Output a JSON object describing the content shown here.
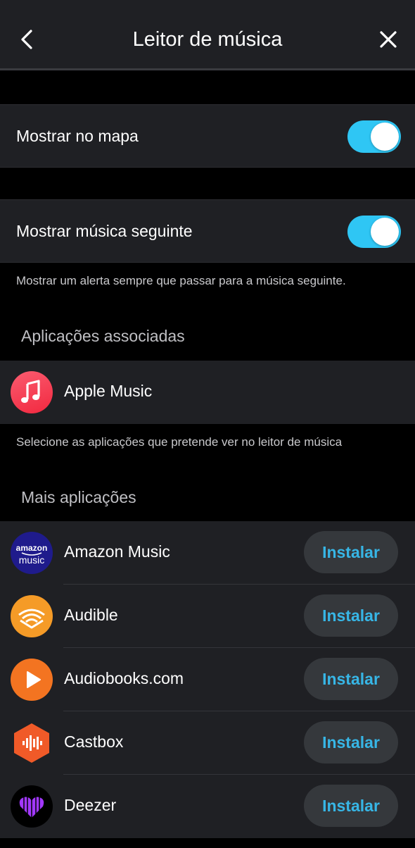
{
  "header": {
    "title": "Leitor de música",
    "back_icon": "chevron-left-icon",
    "close_icon": "close-icon"
  },
  "settings": [
    {
      "label": "Mostrar no mapa",
      "toggle_on": true
    },
    {
      "label": "Mostrar música seguinte",
      "toggle_on": true
    }
  ],
  "next_song_note": "Mostrar um alerta sempre que passar para a música seguinte.",
  "associated": {
    "title": "Aplicações associadas",
    "apps": [
      {
        "name": "Apple Music",
        "icon": "apple-music-icon"
      }
    ],
    "note": "Selecione as aplicações que pretende ver no leitor de música"
  },
  "more": {
    "title": "Mais aplicações",
    "install_label": "Instalar",
    "apps": [
      {
        "name": "Amazon Music",
        "icon": "amazon-music-icon"
      },
      {
        "name": "Audible",
        "icon": "audible-icon"
      },
      {
        "name": "Audiobooks.com",
        "icon": "audiobooks-icon"
      },
      {
        "name": "Castbox",
        "icon": "castbox-icon"
      },
      {
        "name": "Deezer",
        "icon": "deezer-icon"
      }
    ]
  },
  "amazon_logo_text": {
    "line1": "amazon",
    "line2": "music"
  },
  "colors": {
    "accent": "#2fc6f4",
    "install_text": "#37b6e6",
    "row_bg": "#1f2024"
  }
}
